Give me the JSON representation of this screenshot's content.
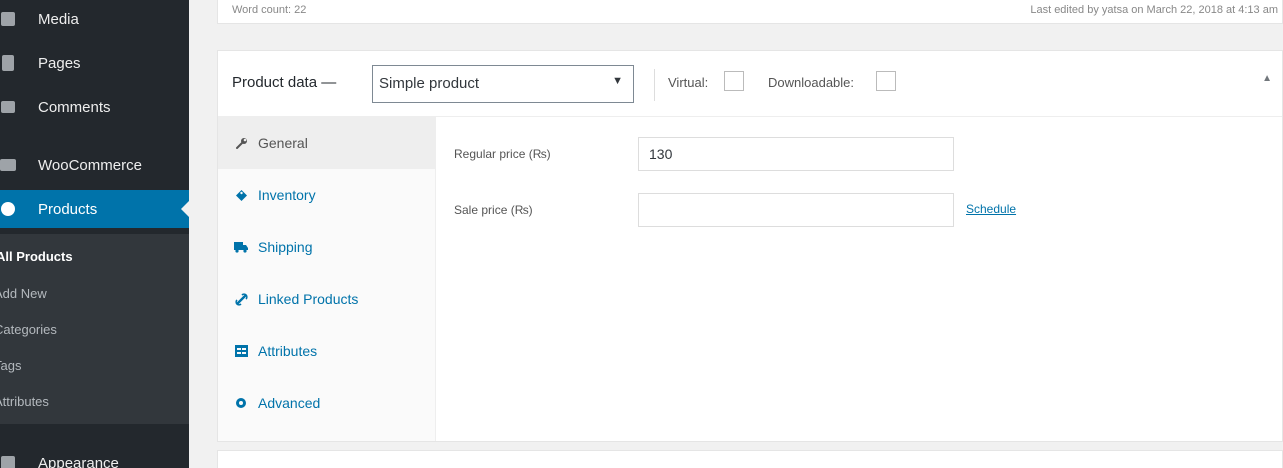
{
  "sidebar": {
    "items": [
      {
        "label": "Media",
        "icon": "media-icon"
      },
      {
        "label": "Pages",
        "icon": "pages-icon"
      },
      {
        "label": "Comments",
        "icon": "comments-icon"
      },
      {
        "label": "WooCommerce",
        "icon": "woocommerce-icon"
      },
      {
        "label": "Products",
        "icon": "products-icon",
        "active": true
      },
      {
        "label": "Appearance",
        "icon": "appearance-icon"
      }
    ],
    "submenu": [
      {
        "label": "All Products",
        "current": true
      },
      {
        "label": "Add New"
      },
      {
        "label": "Categories"
      },
      {
        "label": "Tags"
      },
      {
        "label": "Attributes"
      }
    ]
  },
  "top_strip": {
    "word_count": "Word count: 22",
    "last_edited": "Last edited by yatsa on March 22, 2018 at 4:13 am"
  },
  "product_data": {
    "title": "Product data —",
    "type_select": "Simple product",
    "virtual_label": "Virtual:",
    "downloadable_label": "Downloadable:",
    "virtual_checked": false,
    "downloadable_checked": false
  },
  "tabs": [
    {
      "label": "General",
      "icon": "wrench-icon",
      "active": true
    },
    {
      "label": "Inventory",
      "icon": "tag-icon"
    },
    {
      "label": "Shipping",
      "icon": "truck-icon"
    },
    {
      "label": "Linked Products",
      "icon": "link-icon"
    },
    {
      "label": "Attributes",
      "icon": "table-icon"
    },
    {
      "label": "Advanced",
      "icon": "gear-icon"
    }
  ],
  "general": {
    "regular_price_label": "Regular price (₨)",
    "regular_price_value": "130",
    "sale_price_label": "Sale price (₨)",
    "sale_price_value": "",
    "schedule_link": "Schedule"
  },
  "colors": {
    "sidebar_bg": "#23282d",
    "accent": "#0073aa",
    "page_bg": "#f1f1f1"
  }
}
